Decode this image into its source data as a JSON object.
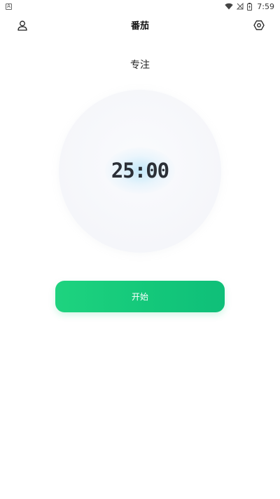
{
  "status_bar": {
    "notification_letter": "A",
    "time": "7:59",
    "icons": [
      "wifi-icon",
      "cellular-off-icon",
      "battery-icon"
    ]
  },
  "header": {
    "title": "番茄",
    "left_icon": "user-icon",
    "right_icon": "settings-icon"
  },
  "timer": {
    "mode_label": "专注",
    "display": "25:00"
  },
  "actions": {
    "start_label": "开始"
  },
  "colors": {
    "accent": "#14C97B",
    "text_primary": "#222222",
    "circle_bg": "#F4F5F9",
    "glow": "#9AD7F5"
  }
}
